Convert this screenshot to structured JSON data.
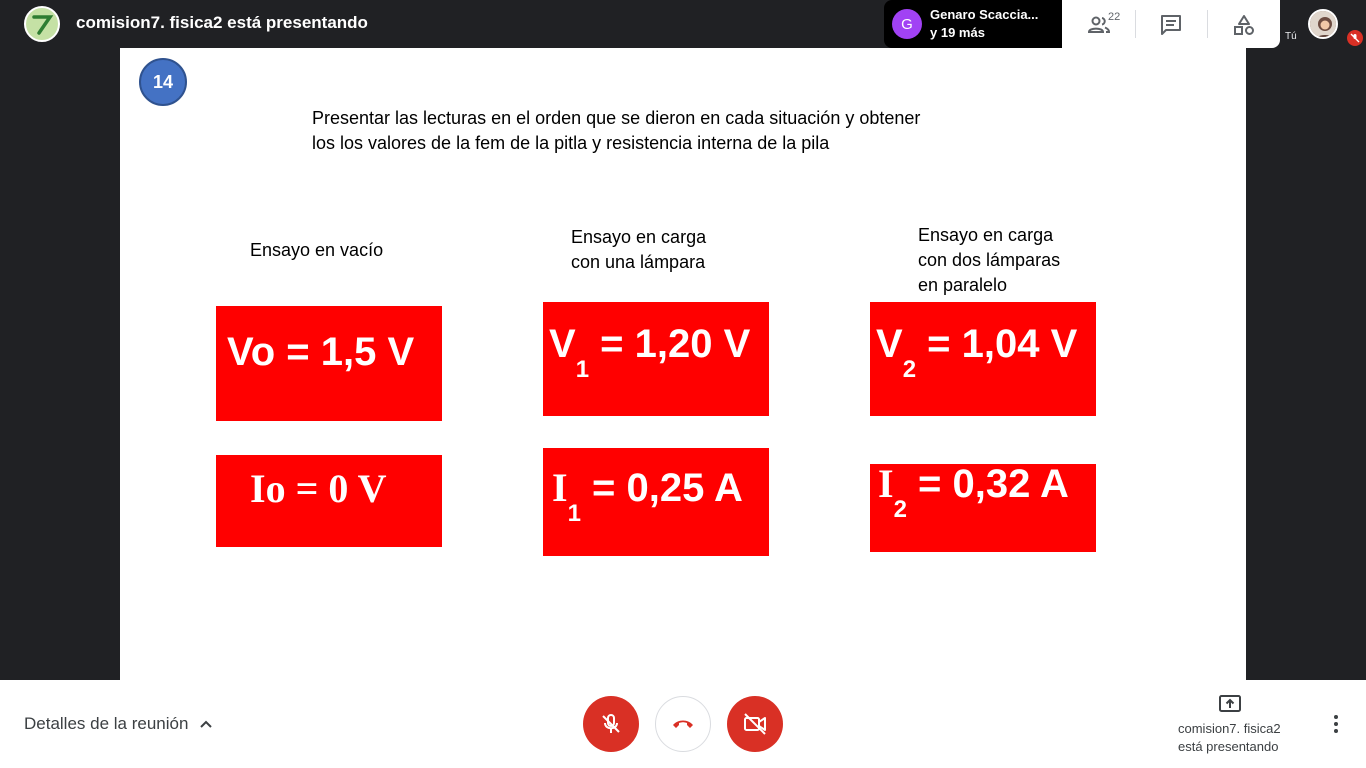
{
  "header": {
    "presenter_title": "comision7. fisica2 está presentando",
    "participant_name": "Genaro Scaccia...",
    "participant_initial": "G",
    "participant_more": "y 19 más",
    "people_count": "22",
    "you_label": "Tú"
  },
  "slide": {
    "number": "14",
    "instructions_line1": "Presentar las lecturas en el orden que se dieron en cada situación y obtener",
    "instructions_line2": "los los valores de  la fem de la pitla y  resistencia interna de la pila",
    "col1_title": "Ensayo en vacío",
    "col2_title_line1": "Ensayo en carga",
    "col2_title_line2": "con una lámpara",
    "col3_title_line1": "Ensayo en carga",
    "col3_title_line2": "con dos lámparas",
    "col3_title_line3": "en paralelo",
    "v0": "Vo =  1,5 V",
    "i0": "Io =  0 V",
    "v1_sym": "V",
    "v1_sub": "1",
    "v1_val": " =  1,20 V",
    "i1_sym": "I",
    "i1_sub": "1",
    "i1_val": " =  0,25 A",
    "v2_sym": "V",
    "v2_sub": "2",
    "v2_val": " =  1,04 V",
    "i2_sym": "I",
    "i2_sub": "2",
    "i2_val": " =  0,32 A"
  },
  "footer": {
    "meeting_details": "Detalles de la reunión",
    "present_line1": "comision7. fisica2",
    "present_line2": "está presentando"
  },
  "icons": {
    "mic": "mic-off-icon",
    "hangup": "call-end-icon",
    "camera": "videocam-off-icon",
    "people": "people-icon",
    "chat": "chat-icon",
    "activities": "shapes-icon",
    "present": "present-to-all-icon",
    "more": "more-vert-icon"
  },
  "colors": {
    "accent_red": "#d93025",
    "slide_box_red": "#ff0000",
    "slide_number_blue": "#4472c4"
  }
}
